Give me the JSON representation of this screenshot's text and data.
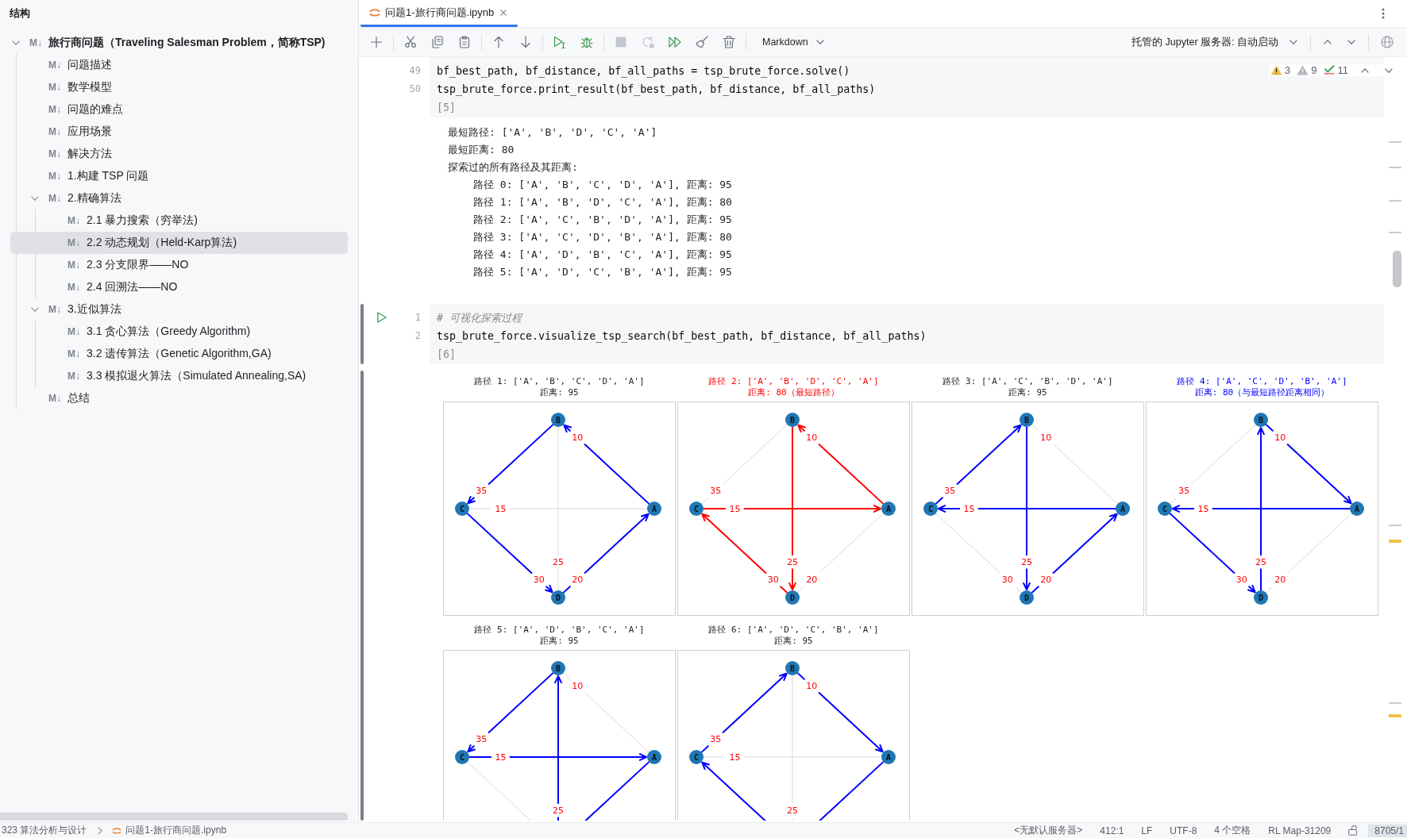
{
  "sidebar": {
    "title": "结构",
    "tree": [
      {
        "badge": "M↓",
        "label": "旅行商问题（Traveling Salesman Problem，简称TSP)",
        "selected": false,
        "expanded": true,
        "children": [
          {
            "badge": "M↓",
            "label": "问题描述",
            "selected": false
          },
          {
            "badge": "M↓",
            "label": "数学模型",
            "selected": false
          },
          {
            "badge": "M↓",
            "label": "问题的难点",
            "selected": false
          },
          {
            "badge": "M↓",
            "label": "应用场景",
            "selected": false
          },
          {
            "badge": "M↓",
            "label": "解决方法",
            "selected": false
          },
          {
            "badge": "M↓",
            "label": "1.构建 TSP 问题",
            "selected": false
          },
          {
            "badge": "M↓",
            "label": "2.精确算法",
            "selected": false,
            "expanded": true,
            "children": [
              {
                "badge": "M↓",
                "label": "2.1 暴力搜索（穷举法)",
                "selected": false
              },
              {
                "badge": "M↓",
                "label": "2.2 动态规划（Held-Karp算法)",
                "selected": true
              },
              {
                "badge": "M↓",
                "label": "2.3 分支限界——NO",
                "selected": false
              },
              {
                "badge": "M↓",
                "label": "2.4 回溯法——NO",
                "selected": false
              }
            ]
          },
          {
            "badge": "M↓",
            "label": "3.近似算法",
            "selected": false,
            "expanded": true,
            "children": [
              {
                "badge": "M↓",
                "label": "3.1 贪心算法（Greedy Algorithm)",
                "selected": false
              },
              {
                "badge": "M↓",
                "label": "3.2 遗传算法（Genetic Algorithm,GA)",
                "selected": false
              },
              {
                "badge": "M↓",
                "label": "3.3 模拟退火算法（Simulated Annealing,SA)",
                "selected": false
              }
            ]
          },
          {
            "badge": "M↓",
            "label": "总结",
            "selected": false
          }
        ]
      }
    ]
  },
  "tabs": [
    {
      "label": "问题1-旅行商问题.ipynb",
      "selected": true
    }
  ],
  "toolbar": {
    "groups": [
      [
        {
          "kind": "add",
          "disabled": false
        }
      ],
      [
        {
          "kind": "cut",
          "disabled": false
        },
        {
          "kind": "copy",
          "disabled": false
        },
        {
          "kind": "paste",
          "disabled": false
        }
      ],
      [
        {
          "kind": "move_up",
          "disabled": false
        },
        {
          "kind": "move_down",
          "disabled": false
        }
      ],
      [
        {
          "kind": "run",
          "disabled": false
        },
        {
          "kind": "debug",
          "disabled": false
        }
      ],
      [
        {
          "kind": "stop",
          "disabled": true
        },
        {
          "kind": "restart",
          "disabled": true
        },
        {
          "kind": "run_all",
          "disabled": false
        },
        {
          "kind": "clear",
          "disabled": false
        },
        {
          "kind": "delete",
          "disabled": false
        }
      ]
    ],
    "cell_type": "Markdown",
    "server": "托管的 Jupyter 服务器: 自动启动"
  },
  "inspections": [
    {
      "kind": "warning",
      "count": "3"
    },
    {
      "kind": "weak_warning",
      "count": "9"
    },
    {
      "kind": "typo",
      "count": "11"
    }
  ],
  "cells": [
    {
      "selected": false,
      "lines": [
        {
          "kind": "code",
          "number": "49",
          "text": "bf_best_path, bf_distance, bf_all_paths = tsp_brute_force.solve()"
        },
        {
          "kind": "code",
          "number": "50",
          "text": "tsp_brute_force.print_result(bf_best_path, bf_distance, bf_all_paths)"
        }
      ],
      "execution_count": "[5]",
      "output": {
        "kind": "text",
        "lines": [
          {
            "text": "最短路径: ['A', 'B', 'D', 'C', 'A']"
          },
          {
            "text": "最短距离: 80"
          },
          {
            "text": "探索过的所有路径及其距离:",
            "children": [
              {
                "text": "路径 0: ['A', 'B', 'C', 'D', 'A'], 距离: 95"
              },
              {
                "text": "路径 1: ['A', 'B', 'D', 'C', 'A'], 距离: 80"
              },
              {
                "text": "路径 2: ['A', 'C', 'B', 'D', 'A'], 距离: 95"
              },
              {
                "text": "路径 3: ['A', 'C', 'D', 'B', 'A'], 距离: 80"
              },
              {
                "text": "路径 4: ['A', 'D', 'B', 'C', 'A'], 距离: 95"
              },
              {
                "text": "路径 5: ['A', 'D', 'C', 'B', 'A'], 距离: 95"
              }
            ]
          }
        ]
      }
    },
    {
      "selected": true,
      "lines": [
        {
          "kind": "comment",
          "number": "1",
          "text": "# 可视化探索过程"
        },
        {
          "kind": "code",
          "number": "2",
          "text": "tsp_brute_force.visualize_tsp_search(bf_best_path, bf_distance, bf_all_paths)"
        }
      ],
      "execution_count": "[6]",
      "output": {
        "kind": "graphs",
        "graphs": [
          {
            "kind": "other",
            "title": "路径 1: ['A', 'B', 'C', 'D', 'A']",
            "subtitle": "距离: 95",
            "nodes": [
              {
                "label": "A"
              },
              {
                "label": "B"
              },
              {
                "label": "C"
              },
              {
                "label": "D"
              }
            ],
            "edges": [
              {
                "weight": "10",
                "kind": "forward"
              },
              {
                "weight": "35",
                "kind": "forward"
              },
              {
                "weight": "15",
                "kind": "plain"
              },
              {
                "weight": "25",
                "kind": "plain"
              },
              {
                "weight": "30",
                "kind": "forward"
              },
              {
                "weight": "20",
                "kind": "forward"
              }
            ]
          },
          {
            "kind": "best",
            "title": "路径 2: ['A', 'B', 'D', 'C', 'A']",
            "subtitle": "距离: 80（最短路径）",
            "nodes": [
              {
                "label": "A"
              },
              {
                "label": "B"
              },
              {
                "label": "C"
              },
              {
                "label": "D"
              }
            ],
            "edges": [
              {
                "weight": "10",
                "kind": "forward"
              },
              {
                "weight": "35",
                "kind": "plain"
              },
              {
                "weight": "15",
                "kind": "forward"
              },
              {
                "weight": "25",
                "kind": "forward"
              },
              {
                "weight": "30",
                "kind": "reverse"
              },
              {
                "weight": "20",
                "kind": "plain"
              }
            ]
          },
          {
            "kind": "other",
            "title": "路径 3: ['A', 'C', 'B', 'D', 'A']",
            "subtitle": "距离: 95",
            "nodes": [
              {
                "label": "A"
              },
              {
                "label": "B"
              },
              {
                "label": "C"
              },
              {
                "label": "D"
              }
            ],
            "edges": [
              {
                "weight": "10",
                "kind": "plain"
              },
              {
                "weight": "35",
                "kind": "reverse"
              },
              {
                "weight": "15",
                "kind": "reverse"
              },
              {
                "weight": "25",
                "kind": "forward"
              },
              {
                "weight": "30",
                "kind": "plain"
              },
              {
                "weight": "20",
                "kind": "forward"
              }
            ]
          },
          {
            "kind": "tie",
            "title": "路径 4: ['A', 'C', 'D', 'B', 'A']",
            "subtitle": "距离: 80（与最短路径距离相同）",
            "nodes": [
              {
                "label": "A"
              },
              {
                "label": "B"
              },
              {
                "label": "C"
              },
              {
                "label": "D"
              }
            ],
            "edges": [
              {
                "weight": "10",
                "kind": "reverse"
              },
              {
                "weight": "35",
                "kind": "plain"
              },
              {
                "weight": "15",
                "kind": "reverse"
              },
              {
                "weight": "25",
                "kind": "reverse"
              },
              {
                "weight": "30",
                "kind": "forward"
              },
              {
                "weight": "20",
                "kind": "plain"
              }
            ]
          },
          {
            "kind": "other",
            "title": "路径 5: ['A', 'D', 'B', 'C', 'A']",
            "subtitle": "距离: 95",
            "nodes": [
              {
                "label": "A"
              },
              {
                "label": "B"
              },
              {
                "label": "C"
              }
            ],
            "edges": [
              {
                "weight": "10",
                "kind": "plain"
              },
              {
                "weight": "35",
                "kind": "forward"
              },
              {
                "weight": "15",
                "kind": "forward"
              },
              {
                "weight": "25",
                "kind": "reverse"
              },
              {
                "kind": "plain"
              },
              {
                "kind": "reverse"
              }
            ]
          },
          {
            "kind": "other",
            "title": "路径 6: ['A', 'D', 'C', 'B', 'A']",
            "subtitle": "距离: 95",
            "nodes": [
              {
                "label": "A"
              },
              {
                "label": "B"
              },
              {
                "label": "C"
              }
            ],
            "edges": [
              {
                "weight": "10",
                "kind": "reverse"
              },
              {
                "weight": "35",
                "kind": "reverse"
              },
              {
                "weight": "15",
                "kind": "plain"
              },
              {
                "weight": "25",
                "kind": "plain"
              },
              {
                "kind": "reverse"
              },
              {
                "kind": "reverse"
              }
            ]
          }
        ]
      }
    }
  ],
  "status_bar": {
    "breadcrumbs": [
      {
        "kind": "project",
        "label": "323 算法分析与设计"
      },
      {
        "kind": "notebook",
        "label": "问题1-旅行商问题.ipynb"
      }
    ],
    "items": [
      "<无默认服务器>",
      "412:1",
      "LF",
      "UTF-8",
      "4 个空格",
      "RL Map-31209"
    ],
    "memory": "8705/1"
  }
}
